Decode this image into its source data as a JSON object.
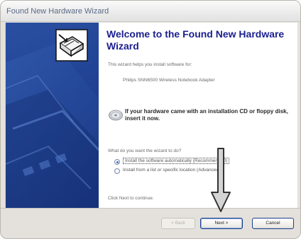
{
  "window": {
    "title": "Found New Hardware Wizard"
  },
  "wizard": {
    "heading": "Welcome to the Found New Hardware Wizard",
    "intro": "This wizard helps you install software for:",
    "device_name": "Philips SNN6500 Wireless Notebook Adapter",
    "cd_prompt": "If your hardware came with an installation CD or floppy disk, insert it now.",
    "question": "What do you want the wizard to do?",
    "options": [
      {
        "label": "Install the software automatically (Recommended)",
        "selected": true
      },
      {
        "label": "Install from a list or specific location (Advanced)",
        "selected": false
      }
    ],
    "continue_hint": "Click Next to continue."
  },
  "buttons": {
    "back": "< Back",
    "next": "Next >",
    "cancel": "Cancel"
  },
  "icons": {
    "wizard_graphic": "hardware-wizard-icon",
    "cd": "cd-icon",
    "annotation": "down-arrow-icon"
  },
  "colors": {
    "heading": "#1a1f8f",
    "side_panel": "#1f3f8f",
    "button_border": "#1c3e8e"
  }
}
